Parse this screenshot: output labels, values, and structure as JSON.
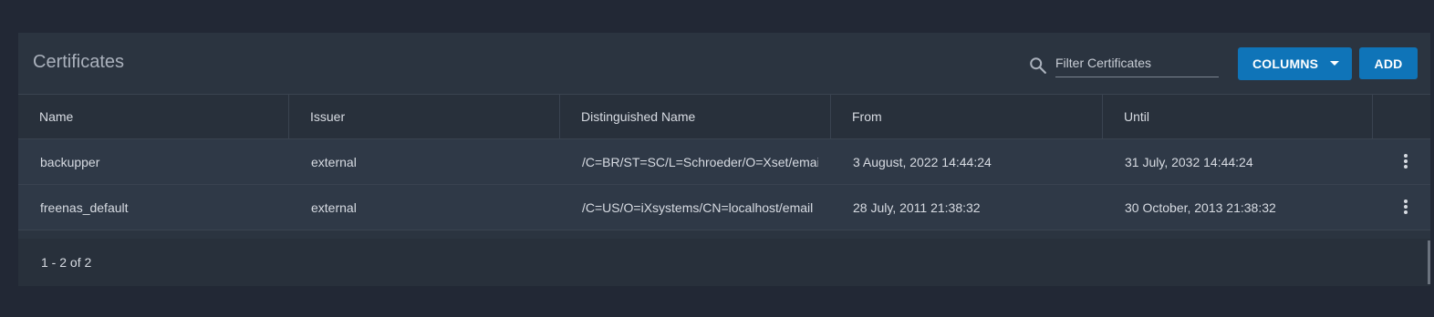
{
  "card": {
    "title": "Certificates",
    "search": {
      "icon": "search-icon",
      "placeholder": "Filter Certificates",
      "value": ""
    },
    "columns_button": "COLUMNS",
    "add_button": "ADD"
  },
  "table": {
    "columns": [
      "Name",
      "Issuer",
      "Distinguished Name",
      "From",
      "Until"
    ],
    "rows": [
      {
        "name": "backupper",
        "issuer": "external",
        "dn": "/C=BR/ST=SC/L=Schroeder/O=Xset/emai",
        "from": "3 August, 2022 14:44:24",
        "until": "31 July, 2032 14:44:24"
      },
      {
        "name": "freenas_default",
        "issuer": "external",
        "dn": "/C=US/O=iXsystems/CN=localhost/email",
        "from": "28 July, 2011 21:38:32",
        "until": "30 October, 2013 21:38:32"
      }
    ]
  },
  "footer": {
    "range": "1 - 2 of 2"
  },
  "colors": {
    "background": "#222835",
    "card": "#2b3440",
    "accent": "#0f74b8"
  }
}
